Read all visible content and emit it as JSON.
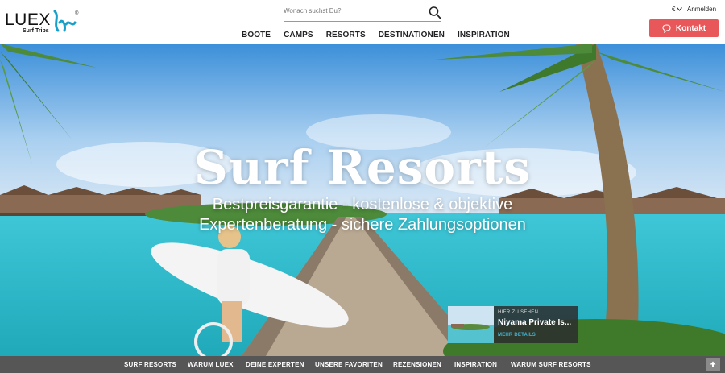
{
  "brand": {
    "name": "LUEX",
    "tagline": "Surf Trips",
    "registered": "®",
    "accent": "#1aa0c8"
  },
  "search": {
    "placeholder": "Wonach suchst Du?",
    "icon": "search-icon"
  },
  "nav": {
    "items": [
      "BOOTE",
      "CAMPS",
      "RESORTS",
      "DESTINATIONEN",
      "INSPIRATION"
    ]
  },
  "account": {
    "currency": "€",
    "login_label": "Anmelden"
  },
  "contact": {
    "label": "Kontakt",
    "icon": "chat-bubbles-icon",
    "color": "#e8585a"
  },
  "hero": {
    "title": "Surf Resorts",
    "subtitle": "Bestpreisgarantie - kostenlose & objektive Expertenberatung - sichere Zahlungsoptionen"
  },
  "teaser": {
    "kicker": "HIER ZU SEHEN",
    "title": "Niyama Private Is...",
    "more_label": "MEHR DETAILS"
  },
  "subnav": {
    "items": [
      "SURF RESORTS",
      "WARUM LUEX",
      "DEINE EXPERTEN",
      "UNSERE FAVORITEN",
      "REZENSIONEN",
      "INSPIRATION",
      "WARUM SURF RESORTS"
    ]
  },
  "scroll_top": {
    "icon": "arrow-up-icon"
  }
}
